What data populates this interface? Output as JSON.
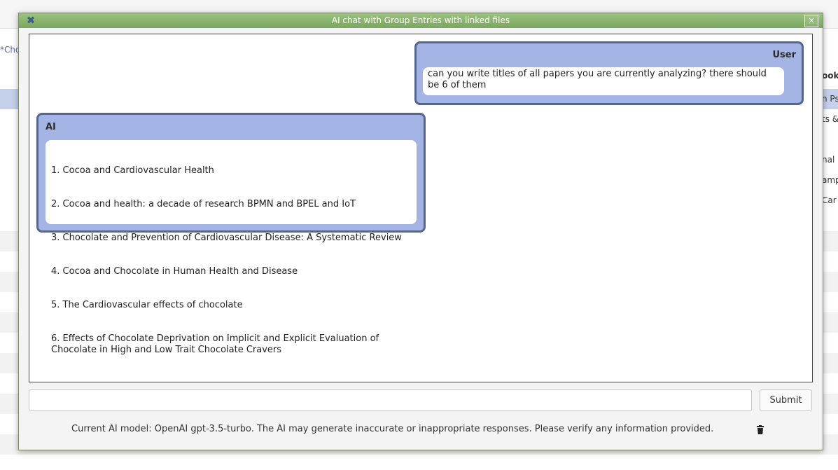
{
  "background": {
    "tab_label": "*Cho",
    "right_column_header": "ook",
    "right_column_cells": [
      "n Ps",
      "ts &",
      "",
      "nal",
      "amp",
      "Car"
    ]
  },
  "dialog": {
    "title": "AI chat with Group Entries with linked files",
    "close_symbol": "×",
    "app_icon": "jabref-icon"
  },
  "chat": {
    "messages": [
      {
        "author": "User",
        "text": "can you write titles of all papers you are currently analyzing? there should be 6 of them"
      },
      {
        "author": "AI",
        "lines": [
          "1. Cocoa and Cardiovascular Health",
          "2. Cocoa and health: a decade of research BPMN and BPEL and IoT",
          "3. Chocolate and Prevention of Cardiovascular Disease: A Systematic Review",
          "4. Cocoa and Chocolate in Human Health and Disease",
          "5. The Cardiovascular effects of chocolate",
          "6. Effects of Chocolate Deprivation on Implicit and Explicit Evaluation of Chocolate in High and Low Trait Chocolate Cravers"
        ]
      }
    ]
  },
  "input": {
    "value": "",
    "placeholder": ""
  },
  "submit_label": "Submit",
  "disclaimer": "Current AI model: OpenAI gpt-3.5-turbo. The AI may generate inaccurate or inappropriate responses. Please verify any information provided.",
  "clear_icon": "trash-icon",
  "colors": {
    "titlebar": "#8bb56e",
    "bubble_fill": "#a4b4e4",
    "bubble_border": "#56678f"
  }
}
